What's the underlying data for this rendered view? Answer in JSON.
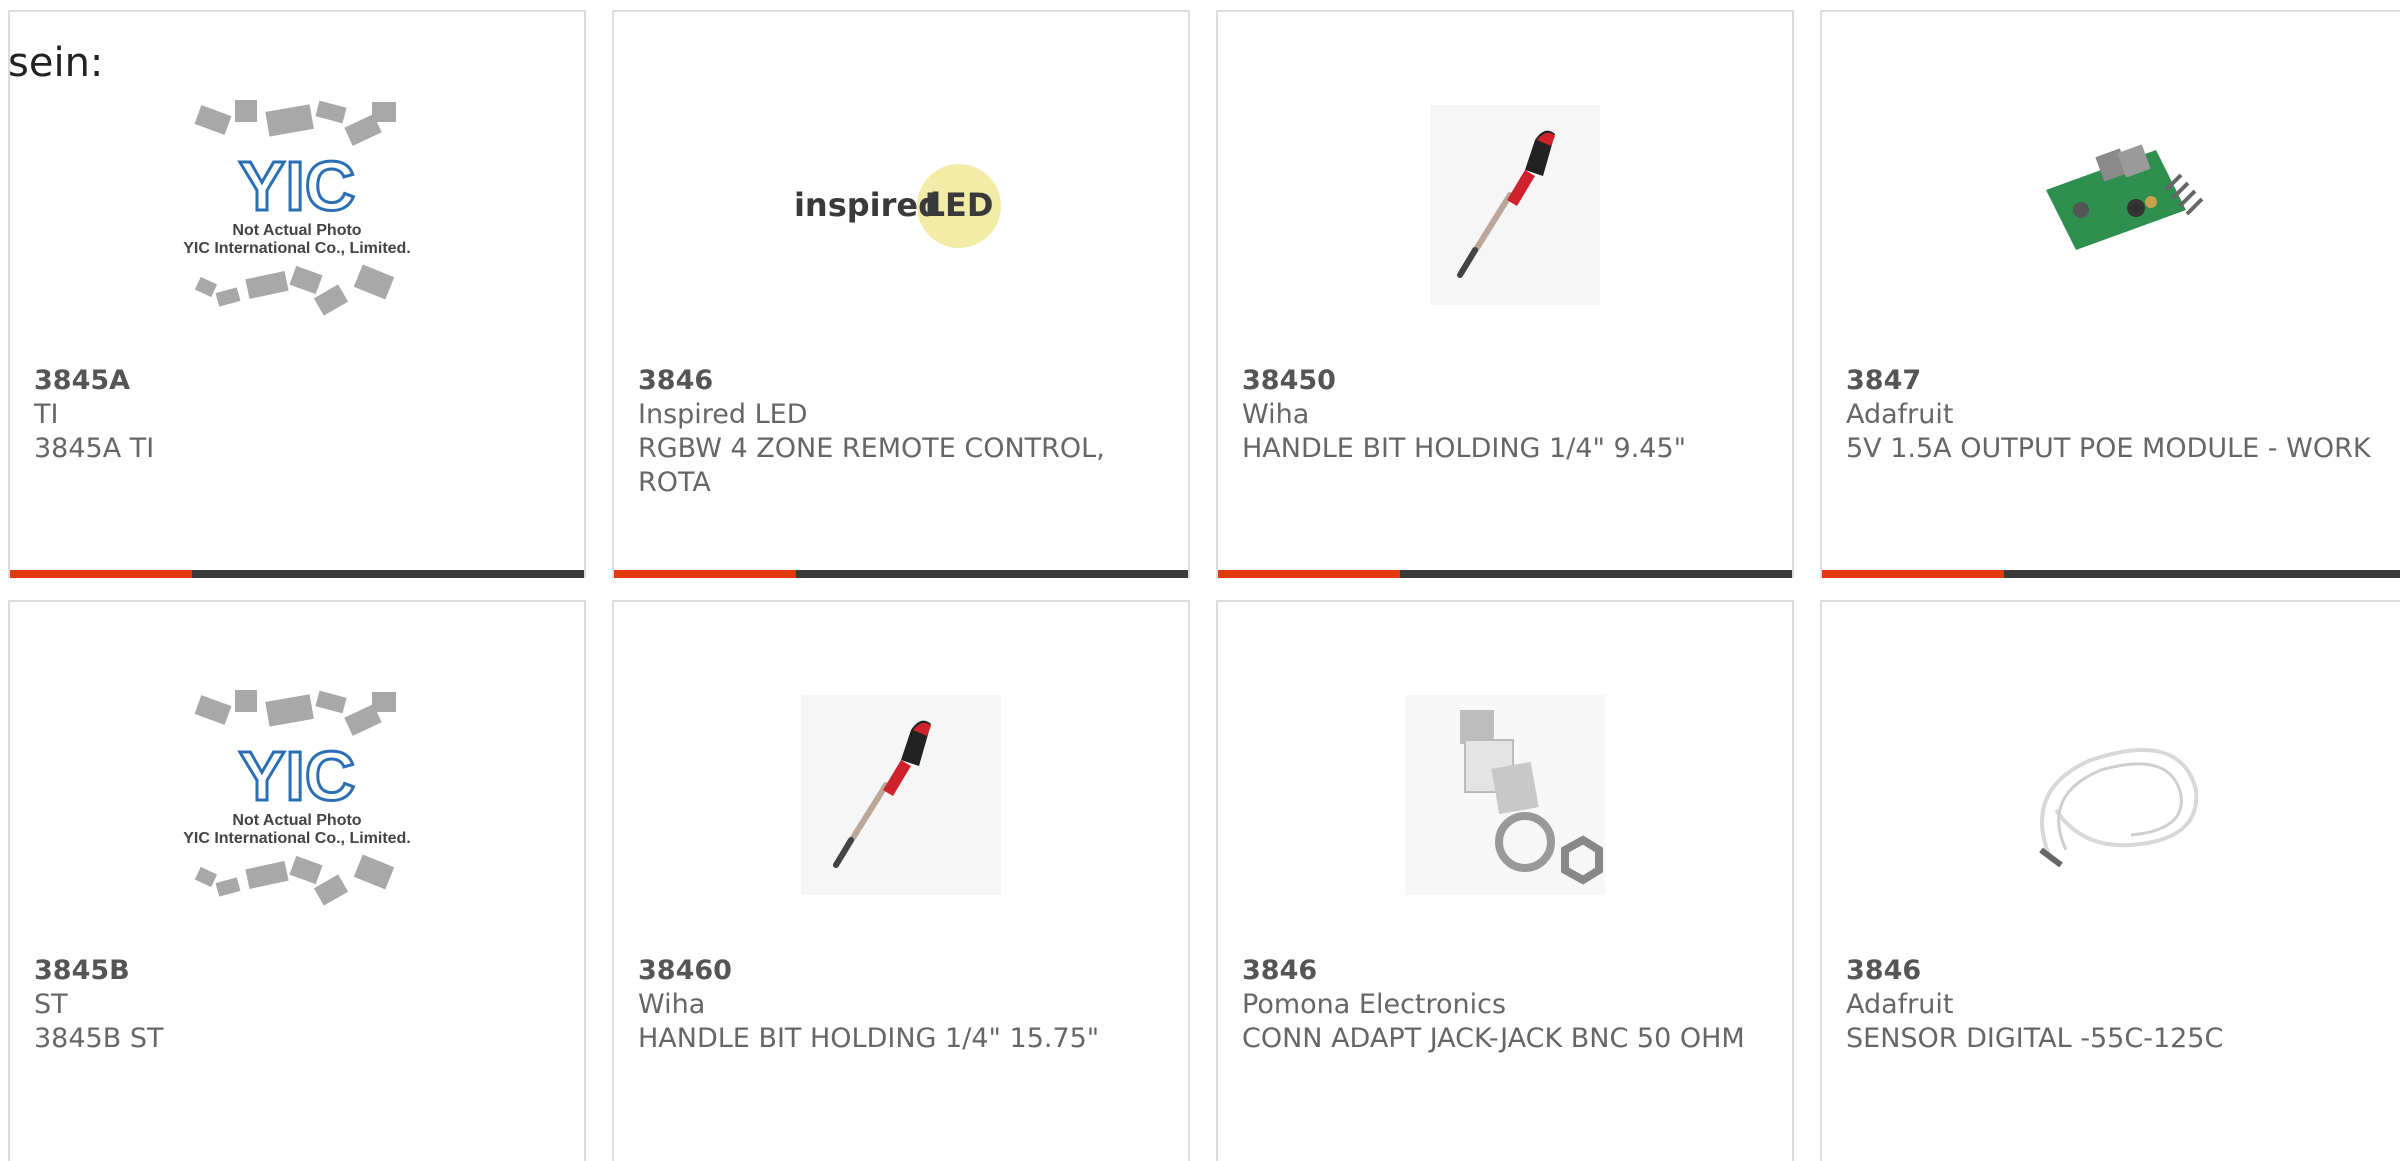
{
  "top_text": "sein:",
  "products": [
    {
      "number": "3845A",
      "brand": "TI",
      "description": "3845A TI",
      "image": "yic-placeholder",
      "image_caption_1": "Not Actual Photo",
      "image_caption_2": "YIC International Co., Limited.",
      "image_logo": "YIC"
    },
    {
      "number": "3846",
      "brand": "Inspired LED",
      "description": "RGBW 4 ZONE REMOTE CONTROL, ROTA",
      "image": "inspired-led-logo",
      "logo_text_1": "inspired",
      "logo_text_2": "LED"
    },
    {
      "number": "38450",
      "brand": "Wiha",
      "description": "HANDLE BIT HOLDING 1/4\" 9.45\"",
      "image": "screwdriver"
    },
    {
      "number": "3847",
      "brand": "Adafruit",
      "description": "5V 1.5A OUTPUT POE MODULE - WORK",
      "image": "circuit-board"
    },
    {
      "number": "3845B",
      "brand": "ST",
      "description": "3845B ST",
      "image": "yic-placeholder",
      "image_caption_1": "Not Actual Photo",
      "image_caption_2": "YIC International Co., Limited.",
      "image_logo": "YIC"
    },
    {
      "number": "38460",
      "brand": "Wiha",
      "description": "HANDLE BIT HOLDING 1/4\" 15.75\"",
      "image": "screwdriver"
    },
    {
      "number": "3846",
      "brand": "Pomona Electronics",
      "description": "CONN ADAPT JACK-JACK BNC 50 OHM",
      "image": "bnc-adapter"
    },
    {
      "number": "3846",
      "brand": "Adafruit",
      "description": "SENSOR DIGITAL -55C-125C",
      "image": "sensor-cable"
    }
  ],
  "colors": {
    "accent": "#e23a0c",
    "bar": "#3a3a3a",
    "text": "#666666",
    "border": "#dddddd"
  }
}
